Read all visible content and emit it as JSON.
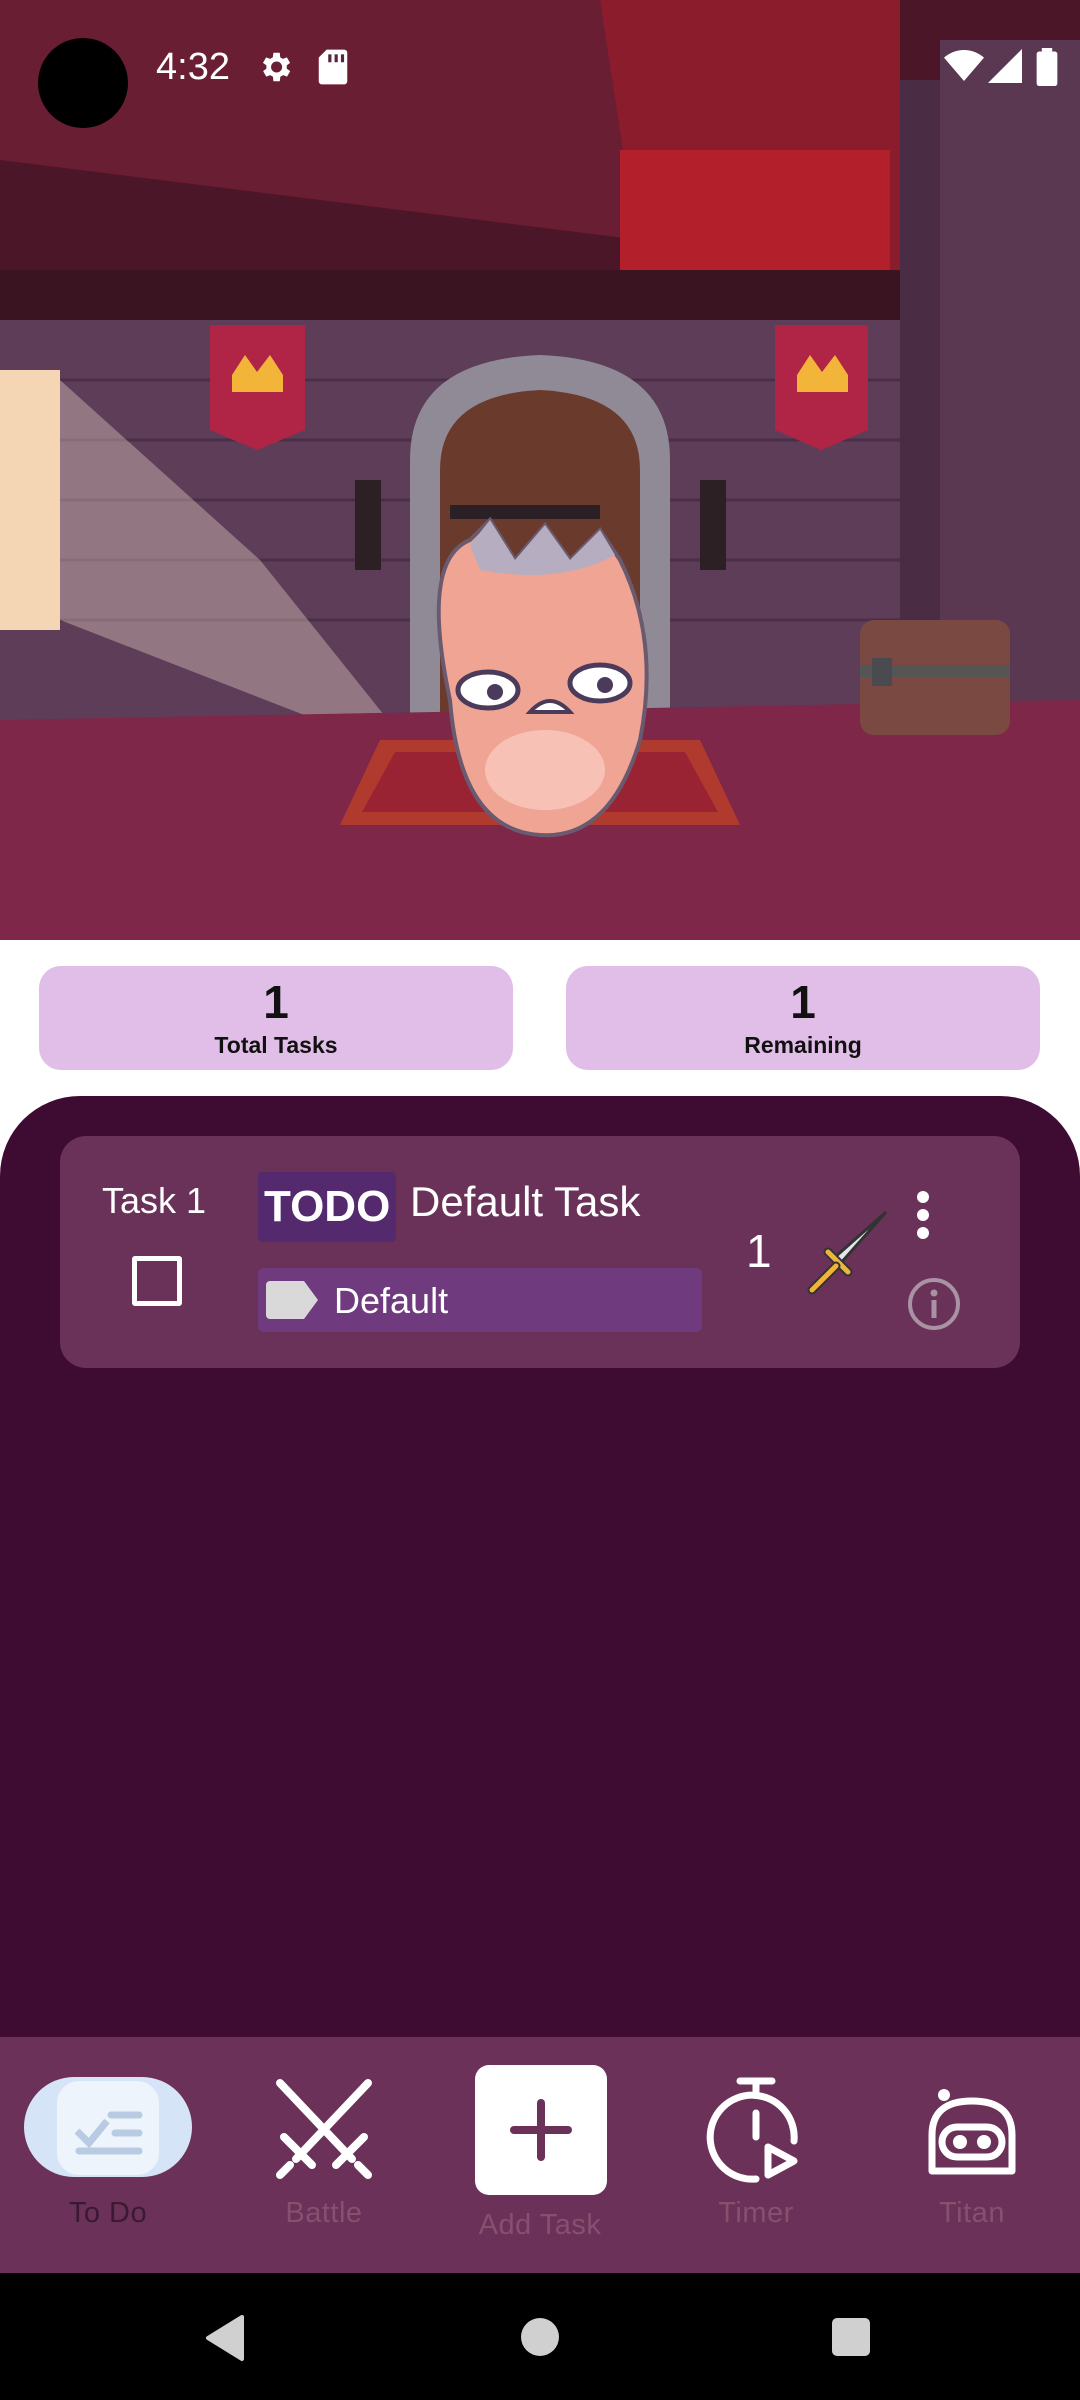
{
  "status_bar": {
    "time": "4:32",
    "icons": [
      "settings-icon",
      "sd-card-icon",
      "wifi-icon",
      "cell-signal-icon",
      "battery-icon"
    ]
  },
  "stats": {
    "total": {
      "value": "1",
      "label": "Total Tasks"
    },
    "remaining": {
      "value": "1",
      "label": "Remaining"
    }
  },
  "task": {
    "number_label": "Task 1",
    "status_badge": "TODO",
    "title": "Default Task",
    "tag": "Default",
    "damage": "1",
    "completed": false
  },
  "nav": {
    "items": [
      {
        "label": "To Do",
        "icon": "checklist-icon",
        "active": true
      },
      {
        "label": "Battle",
        "icon": "crossed-swords-icon",
        "active": false
      },
      {
        "label": "Add Task",
        "icon": "plus-icon",
        "active": false
      },
      {
        "label": "Timer",
        "icon": "stopwatch-icon",
        "active": false
      },
      {
        "label": "Titan",
        "icon": "monster-icon",
        "active": false
      }
    ]
  },
  "colors": {
    "stat_card": "#e1bee7",
    "task_panel": "#3e0b33",
    "task_card": "#6a3258",
    "nav_bar": "#6b3159",
    "active_pill": "#d6e4f7"
  }
}
